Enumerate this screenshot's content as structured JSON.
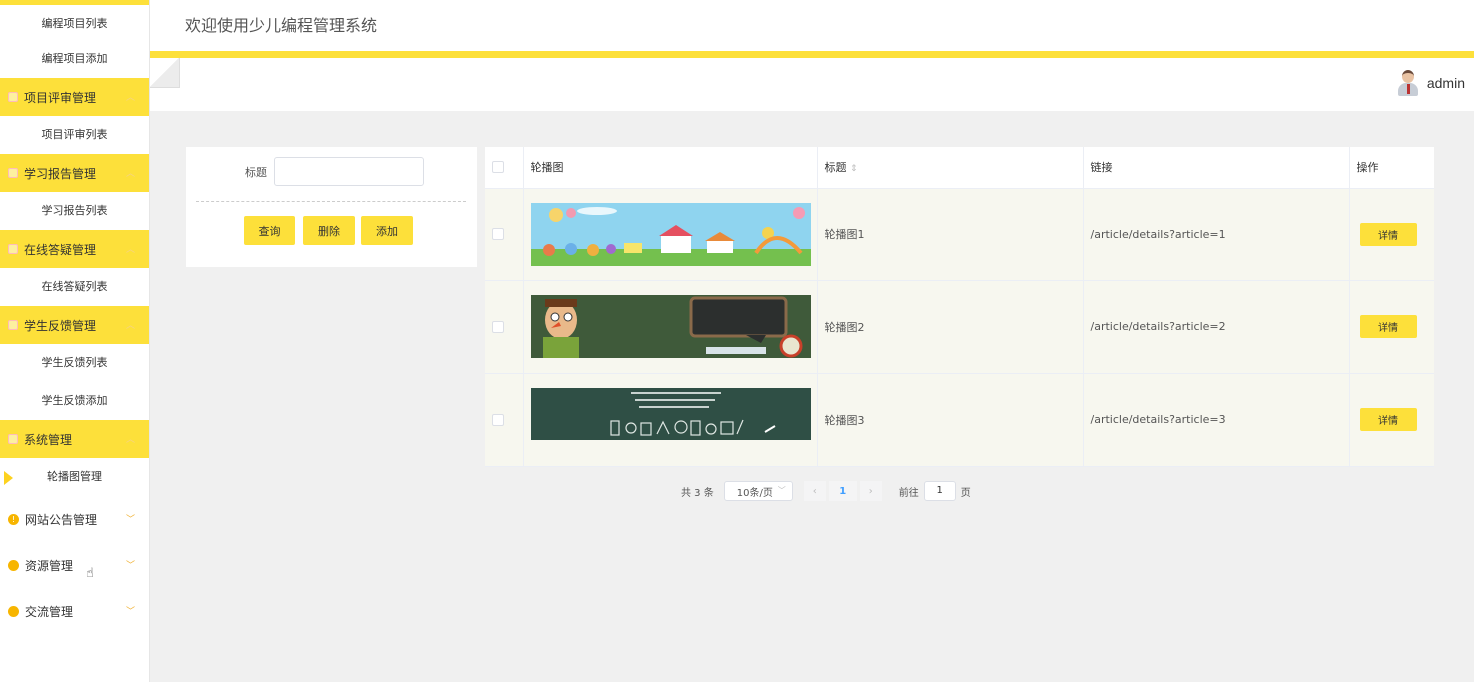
{
  "header": {
    "title": "欢迎使用少儿编程管理系统"
  },
  "user": {
    "name": "admin"
  },
  "sidebar": {
    "items": [
      {
        "type": "sub",
        "label": "编程项目列表"
      },
      {
        "type": "sub",
        "label": "编程项目添加"
      },
      {
        "type": "group",
        "label": "项目评审管理"
      },
      {
        "type": "sub",
        "label": "项目评审列表"
      },
      {
        "type": "group",
        "label": "学习报告管理"
      },
      {
        "type": "sub",
        "label": "学习报告列表"
      },
      {
        "type": "group",
        "label": "在线答疑管理"
      },
      {
        "type": "sub",
        "label": "在线答疑列表"
      },
      {
        "type": "group",
        "label": "学生反馈管理"
      },
      {
        "type": "sub",
        "label": "学生反馈列表"
      },
      {
        "type": "sub",
        "label": "学生反馈添加"
      },
      {
        "type": "group",
        "label": "系统管理"
      },
      {
        "type": "sub",
        "label": "轮播图管理",
        "active": true
      },
      {
        "type": "plain",
        "label": "网站公告管理"
      },
      {
        "type": "plain",
        "label": "资源管理"
      },
      {
        "type": "plain",
        "label": "交流管理"
      }
    ]
  },
  "search": {
    "title_label": "标题",
    "title_value": "",
    "query_label": "查询",
    "delete_label": "删除",
    "add_label": "添加"
  },
  "table": {
    "columns": [
      "轮播图",
      "标题",
      "链接",
      "操作"
    ],
    "sort_glyph": "⇕",
    "rows": [
      {
        "title": "轮播图1",
        "link": "/article/details?article=1",
        "action": "详情"
      },
      {
        "title": "轮播图2",
        "link": "/article/details?article=2",
        "action": "详情"
      },
      {
        "title": "轮播图3",
        "link": "/article/details?article=3",
        "action": "详情"
      }
    ]
  },
  "pagination": {
    "total": "共 3 条",
    "page_size": "10条/页",
    "current_page": "1",
    "goto_label": "前往",
    "goto_value": "1",
    "page_word": "页"
  },
  "colors": {
    "accent": "#fde03a",
    "link_blue": "#409eff"
  }
}
